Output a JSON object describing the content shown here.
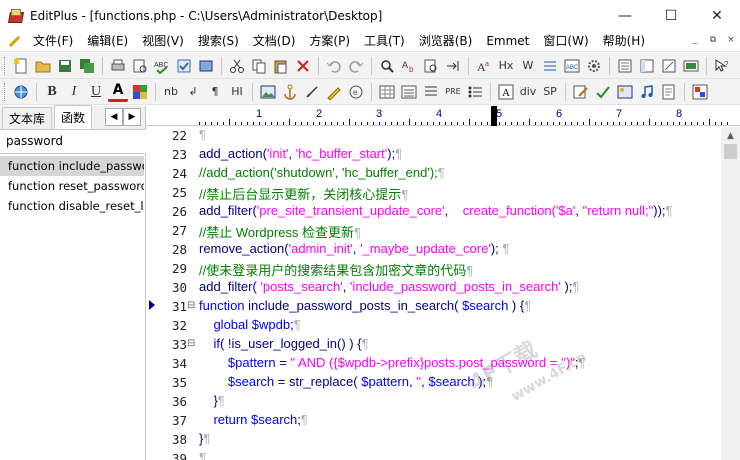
{
  "window": {
    "title": "EditPlus - [functions.php - C:\\Users\\Administrator\\Desktop]",
    "minimize": "—",
    "maximize": "☐",
    "close": "✕"
  },
  "menu": [
    "文件(F)",
    "编辑(E)",
    "视图(V)",
    "搜索(S)",
    "文档(D)",
    "方案(P)",
    "工具(T)",
    "浏览器(B)",
    "Emmet",
    "窗口(W)",
    "帮助(H)"
  ],
  "mdi": [
    "_",
    "⧉",
    "×"
  ],
  "toolbar2_labels": {
    "bold": "B",
    "italic": "I",
    "underline": "U",
    "font": "A",
    "nb": "nb",
    "enter": "↲",
    "para": "¶",
    "hi": "HI",
    "pre": "PRE",
    "div": "div",
    "sp": "SP",
    "hx": "Hx",
    "w": "W"
  },
  "sidebar": {
    "tab1": "文本库",
    "tab2": "函数",
    "search": "password",
    "items": [
      "function include_password_posts_in_search",
      "function reset_password_",
      "function disable_reset_lost_password"
    ]
  },
  "ruler": [
    "1",
    "2",
    "3",
    "4",
    "5",
    "6",
    "7",
    "8"
  ],
  "colors": {
    "keyword": "#0000ff",
    "function": "#000080",
    "string": "#ff00ff",
    "comment": "#008000",
    "variable": "#000080",
    "plain": "#000080",
    "pilcrow": "#b0b0b0"
  },
  "code": {
    "lines": [
      {
        "n": "22",
        "segs": [
          {
            "t": "¶",
            "c": "pilcrow"
          }
        ]
      },
      {
        "n": "23",
        "segs": [
          {
            "t": "add_action(",
            "c": "plain"
          },
          {
            "t": "'init'",
            "c": "string"
          },
          {
            "t": ", ",
            "c": "plain"
          },
          {
            "t": "'hc_buffer_start'",
            "c": "string"
          },
          {
            "t": ");",
            "c": "plain"
          },
          {
            "t": "¶",
            "c": "pilcrow"
          }
        ]
      },
      {
        "n": "24",
        "segs": [
          {
            "t": "//add_action('shutdown', 'hc_buffer_end');",
            "c": "comment"
          },
          {
            "t": "¶",
            "c": "pilcrow"
          }
        ]
      },
      {
        "n": "25",
        "segs": [
          {
            "t": "//禁止后台显示更新，关闭核心提示",
            "c": "comment"
          },
          {
            "t": "¶",
            "c": "pilcrow"
          }
        ]
      },
      {
        "n": "26",
        "segs": [
          {
            "t": "add_filter(",
            "c": "plain"
          },
          {
            "t": "'pre_site_transient_update_core'",
            "c": "string"
          },
          {
            "t": ",    ",
            "c": "plain"
          },
          {
            "t": "create_function(",
            "c": "string"
          },
          {
            "t": "'$a'",
            "c": "string"
          },
          {
            "t": ", ",
            "c": "plain"
          },
          {
            "t": "\"return null;\"",
            "c": "string"
          },
          {
            "t": "));",
            "c": "plain"
          },
          {
            "t": "¶",
            "c": "pilcrow"
          }
        ]
      },
      {
        "n": "27",
        "segs": [
          {
            "t": "//禁止 Wordpress 检查更新",
            "c": "comment"
          },
          {
            "t": "¶",
            "c": "pilcrow"
          }
        ]
      },
      {
        "n": "28",
        "segs": [
          {
            "t": "remove_action(",
            "c": "plain"
          },
          {
            "t": "'admin_init'",
            "c": "string"
          },
          {
            "t": ", ",
            "c": "plain"
          },
          {
            "t": "'_maybe_update_core'",
            "c": "string"
          },
          {
            "t": "); ",
            "c": "plain"
          },
          {
            "t": "¶",
            "c": "pilcrow"
          }
        ]
      },
      {
        "n": "29",
        "segs": [
          {
            "t": "//使未登录用户的搜索结果包含加密文章的代码",
            "c": "comment"
          },
          {
            "t": "¶",
            "c": "pilcrow"
          }
        ]
      },
      {
        "n": "30",
        "segs": [
          {
            "t": "add_filter( ",
            "c": "plain"
          },
          {
            "t": "'posts_search'",
            "c": "string"
          },
          {
            "t": ", ",
            "c": "plain"
          },
          {
            "t": "'include_password_posts_in_search'",
            "c": "string"
          },
          {
            "t": " );",
            "c": "plain"
          },
          {
            "t": "¶",
            "c": "pilcrow"
          }
        ]
      },
      {
        "n": "31",
        "fold": "⊟",
        "segs": [
          {
            "t": "function ",
            "c": "keyword"
          },
          {
            "t": "include_password_posts_in_search( ",
            "c": "plain"
          },
          {
            "t": "$search",
            "c": "keyword"
          },
          {
            "t": " ) {",
            "c": "plain"
          },
          {
            "t": "¶",
            "c": "pilcrow"
          }
        ]
      },
      {
        "n": "32",
        "segs": [
          {
            "t": "    global ",
            "c": "keyword"
          },
          {
            "t": "$wpdb",
            "c": "keyword"
          },
          {
            "t": ";",
            "c": "plain"
          },
          {
            "t": "¶",
            "c": "pilcrow"
          }
        ]
      },
      {
        "n": "33",
        "fold": "⊟",
        "segs": [
          {
            "t": "    if",
            "c": "keyword"
          },
          {
            "t": "( !is_user_logged_in() ) {",
            "c": "plain"
          },
          {
            "t": "¶",
            "c": "pilcrow"
          }
        ]
      },
      {
        "n": "34",
        "segs": [
          {
            "t": "        $pattern",
            "c": "keyword"
          },
          {
            "t": " = ",
            "c": "plain"
          },
          {
            "t": "\" AND ({$wpdb->prefix}posts.post_password = '')\"",
            "c": "string"
          },
          {
            "t": ";",
            "c": "plain"
          },
          {
            "t": "¶",
            "c": "pilcrow"
          }
        ]
      },
      {
        "n": "35",
        "segs": [
          {
            "t": "        $search",
            "c": "keyword"
          },
          {
            "t": " = str_replace( ",
            "c": "plain"
          },
          {
            "t": "$pattern",
            "c": "keyword"
          },
          {
            "t": ", ",
            "c": "plain"
          },
          {
            "t": "''",
            "c": "string"
          },
          {
            "t": ", ",
            "c": "plain"
          },
          {
            "t": "$search",
            "c": "keyword"
          },
          {
            "t": " );",
            "c": "plain"
          },
          {
            "t": "¶",
            "c": "pilcrow"
          }
        ]
      },
      {
        "n": "36",
        "segs": [
          {
            "t": "    }",
            "c": "plain"
          },
          {
            "t": "¶",
            "c": "pilcrow"
          }
        ]
      },
      {
        "n": "37",
        "segs": [
          {
            "t": "    return ",
            "c": "keyword"
          },
          {
            "t": "$search",
            "c": "keyword"
          },
          {
            "t": ";",
            "c": "plain"
          },
          {
            "t": "¶",
            "c": "pilcrow"
          }
        ]
      },
      {
        "n": "38",
        "segs": [
          {
            "t": "}",
            "c": "plain"
          },
          {
            "t": "¶",
            "c": "pilcrow"
          }
        ]
      },
      {
        "n": "39",
        "segs": [
          {
            "t": "¶",
            "c": "pilcrow"
          }
        ]
      }
    ]
  },
  "watermark": {
    "line1": "4F下载",
    "line2": "www.4F.cn"
  }
}
